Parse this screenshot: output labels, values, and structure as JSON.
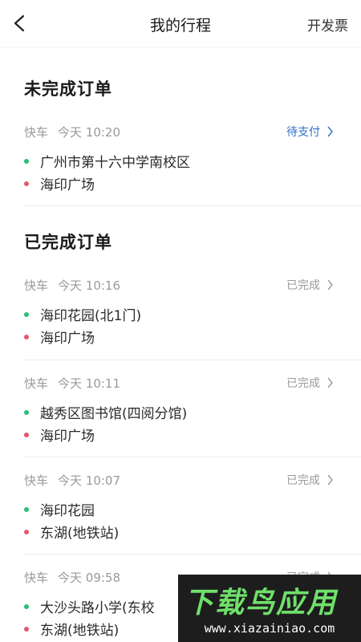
{
  "header": {
    "title": "我的行程",
    "action": "开发票"
  },
  "sections": [
    {
      "title": "未完成订单",
      "orders": [
        {
          "type": "快车",
          "time": "今天 10:20",
          "status": "待支付",
          "from": "广州市第十六中学南校区",
          "to": "海印广场"
        }
      ]
    },
    {
      "title": "已完成订单",
      "orders": [
        {
          "type": "快车",
          "time": "今天 10:16",
          "status": "已完成",
          "from": "海印花园(北1门)",
          "to": "海印广场"
        },
        {
          "type": "快车",
          "time": "今天 10:11",
          "status": "已完成",
          "from": "越秀区图书馆(四阅分馆)",
          "to": "海印广场"
        },
        {
          "type": "快车",
          "time": "今天 10:07",
          "status": "已完成",
          "from": "海印花园",
          "to": "东湖(地铁站)"
        },
        {
          "type": "快车",
          "time": "今天 09:58",
          "status": "已完成",
          "from": "大沙头路小学(东校",
          "to": "东湖(地铁站)"
        }
      ]
    }
  ],
  "watermark": {
    "title": "下载鸟应用",
    "url": "www.xiazainiao.com"
  },
  "colors": {
    "pending_status": "#2f6fc6",
    "start_dot": "#27c07a",
    "end_dot": "#e5566b"
  },
  "icons": {
    "back": "chevron-left-icon",
    "status_arrow": "chevron-right-icon"
  }
}
